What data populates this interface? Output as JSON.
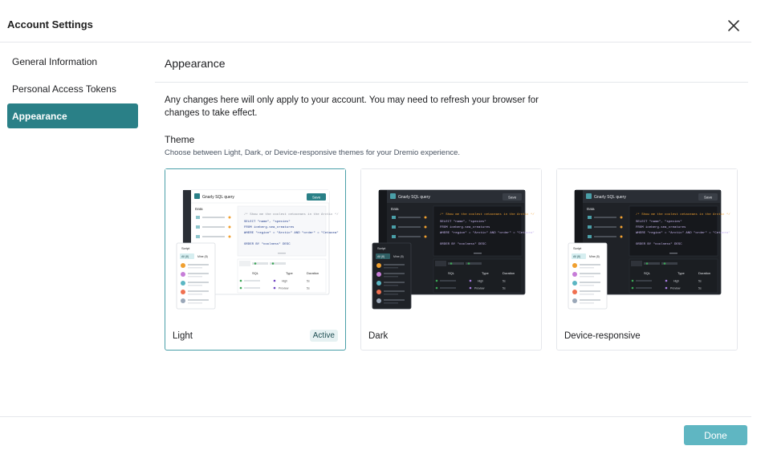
{
  "dialog": {
    "title": "Account Settings",
    "close_icon": "close-icon"
  },
  "sidebar": {
    "items": [
      {
        "label": "General Information",
        "active": false
      },
      {
        "label": "Personal Access Tokens",
        "active": false
      },
      {
        "label": "Appearance",
        "active": true
      }
    ]
  },
  "main": {
    "section_title": "Appearance",
    "notice": "Any changes here will only apply to your account. You may need to refresh your browser for changes to take effect.",
    "theme_label": "Theme",
    "theme_description": "Choose between Light, Dark, or Device-responsive themes for your Dremio experience.",
    "themes": [
      {
        "label": "Light",
        "badge": "Active",
        "selected": true
      },
      {
        "label": "Dark",
        "badge": "",
        "selected": false
      },
      {
        "label": "Device-responsive",
        "badge": "",
        "selected": false
      }
    ],
    "preview": {
      "query_title": "Gnarly SQL query",
      "save_label": "Save",
      "data_label": "Data",
      "script_label": "Script",
      "script_tabs": [
        "All (8)",
        "Mine (8)"
      ],
      "code_lines": [
        "/* Show me the coolest cetaceans in the Arctic */",
        "SELECT \"name\", \"species\"",
        "FROM iceberg.sea_creatures",
        "WHERE \"region\" = \"Arctic\" AND \"order\" = \"Cetacea\"",
        "ORDER BY \"coolness\" DESC"
      ],
      "result_headers": [
        "SQL",
        "Type",
        "Duration"
      ],
      "result_rows": [
        [
          "High",
          "5s"
        ],
        [
          "Preview",
          "5s"
        ]
      ]
    }
  },
  "footer": {
    "done_label": "Done"
  },
  "colors": {
    "accent": "#2a8087",
    "done_button": "#5fb6c2",
    "selected_border": "#4a9fa8"
  }
}
